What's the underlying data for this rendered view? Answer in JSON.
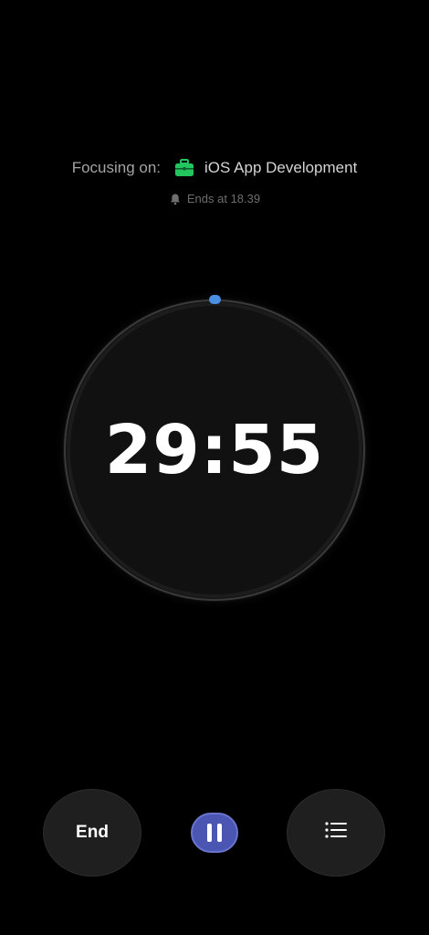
{
  "focus": {
    "label": "Focusing on:",
    "task": "iOS App Development",
    "task_icon": "briefcase-icon",
    "task_icon_color": "#22c55e"
  },
  "ends": {
    "text": "Ends at 18.39",
    "icon": "bell-icon"
  },
  "timer": {
    "display": "29:55",
    "progress_color": "#4a90e2",
    "progress": 0.003
  },
  "controls": {
    "end_label": "End",
    "pause_icon": "pause-icon",
    "pause_color": "#4b56b3",
    "list_icon": "list-icon"
  }
}
